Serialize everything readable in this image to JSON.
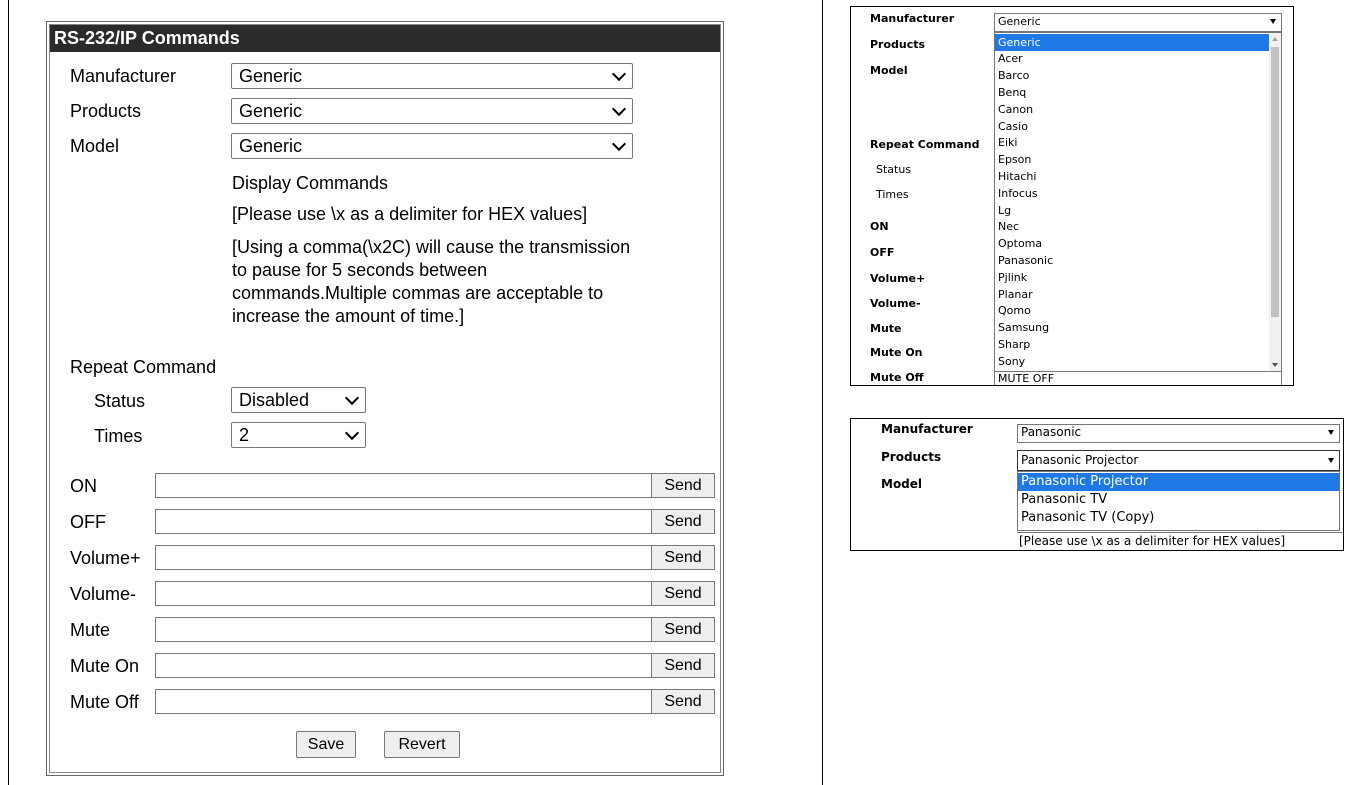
{
  "main": {
    "title": "RS-232/IP Commands",
    "manufacturer_label": "Manufacturer",
    "manufacturer_value": "Generic",
    "products_label": "Products",
    "products_value": "Generic",
    "model_label": "Model",
    "model_value": "Generic",
    "display_commands": "Display Commands",
    "hint_hex": "[Please use \\x as a delimiter for HEX values]",
    "hint_comma_1": "[Using a comma(\\x2C) will cause the transmission",
    "hint_comma_2": "to pause for 5 seconds between",
    "hint_comma_3": "commands.Multiple commas are acceptable to",
    "hint_comma_4": "increase the amount of time.]",
    "repeat_label": "Repeat Command",
    "status_label": "Status",
    "status_value": "Disabled",
    "times_label": "Times",
    "times_value": "2",
    "commands": [
      {
        "label": "ON",
        "value": "",
        "send": "Send"
      },
      {
        "label": "OFF",
        "value": "",
        "send": "Send"
      },
      {
        "label": "Volume+",
        "value": "",
        "send": "Send"
      },
      {
        "label": "Volume-",
        "value": "",
        "send": "Send"
      },
      {
        "label": "Mute",
        "value": "",
        "send": "Send"
      },
      {
        "label": "Mute On",
        "value": "",
        "send": "Send"
      },
      {
        "label": "Mute Off",
        "value": "",
        "send": "Send"
      }
    ],
    "save_label": "Save",
    "revert_label": "Revert"
  },
  "dropdown_panel": {
    "manufacturer_label": "Manufacturer",
    "manufacturer_value": "Generic",
    "labels": [
      "Products",
      "Model",
      "Repeat Command",
      "Status",
      "Times",
      "ON",
      "OFF",
      "Volume+",
      "Volume-",
      "Mute",
      "Mute On",
      "Mute Off"
    ],
    "options": [
      "Generic",
      "Acer",
      "Barco",
      "Benq",
      "Canon",
      "Casio",
      "Eiki",
      "Epson",
      "Hitachi",
      "Infocus",
      "Lg",
      "Nec",
      "Optoma",
      "Panasonic",
      "Pjlink",
      "Planar",
      "Qomo",
      "Samsung",
      "Sharp",
      "Sony"
    ],
    "selected_option": "Generic",
    "mute_off_value": "MUTE OFF"
  },
  "products_panel": {
    "manufacturer_label": "Manufacturer",
    "manufacturer_value": "Panasonic",
    "products_label": "Products",
    "products_value": "Panasonic Projector",
    "model_label": "Model",
    "options": [
      "Panasonic Projector",
      "Panasonic TV",
      "Panasonic TV (Copy)"
    ],
    "selected_option": "Panasonic Projector",
    "hint_hex": "[Please use \\x as a delimiter for HEX values]"
  },
  "colors": {
    "title_bar": "#2b2b2b",
    "highlight": "#1e79e6"
  }
}
